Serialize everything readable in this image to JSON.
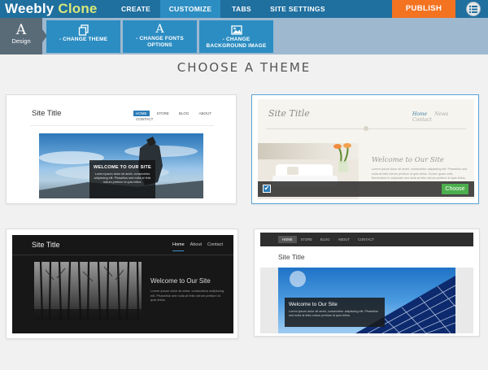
{
  "app": {
    "logo_primary": "Weebly",
    "logo_secondary": "Clone"
  },
  "topnav": {
    "tabs": [
      {
        "label": "CREATE",
        "active": false
      },
      {
        "label": "CUSTOMIZE",
        "active": true
      },
      {
        "label": "TABS",
        "active": false
      },
      {
        "label": "SITE SETTINGS",
        "active": false
      }
    ],
    "publish_label": "PUBLISH",
    "menu_icon": "list-menu-icon"
  },
  "subnav": {
    "design_label": "Design",
    "design_glyph": "A",
    "buttons": [
      {
        "label": "- CHANGE THEME",
        "icon": "copy-icon"
      },
      {
        "label": "- CHANGE FONTS OPTIONS",
        "glyph": "A",
        "icon": "font-icon"
      },
      {
        "label": "- CHANGE BACKGROUND IMAGE",
        "icon": "image-icon"
      }
    ]
  },
  "main": {
    "heading": "CHOOSE A THEME"
  },
  "themes": [
    {
      "site_title": "Site Title",
      "nav": [
        "HOME",
        "STORE",
        "BLOG",
        "ABOUT",
        "CONTACT"
      ],
      "hero_heading": "WELCOME TO OUR SITE",
      "hero_body": "Lorem ipsum dolor sit amet, consectetur adipiscing elit. Phasellus sed nulla at felis rutrum pretium id quis tellus.",
      "selected": false
    },
    {
      "site_title": "Site Title",
      "nav": [
        "Home",
        "News",
        "Contact"
      ],
      "welcome": "Welcome to Our Site",
      "body": "Lorem ipsum dolor sit amet, consectetur adipiscing elit. Phasellus sed nulla at felis rutrum pretium id quis tellus. Donec quam velit, fermentum in vulputate sed nulla at felis rutrum pretium id quis tellus.",
      "selected": true,
      "choose_label": "Choose",
      "check_glyph": "✔"
    },
    {
      "site_title": "Site Title",
      "nav": [
        "Home",
        "About",
        "Contact"
      ],
      "welcome": "Welcome to Our Site",
      "body": "Lorem ipsum dolor sit amet, consectetur adipiscing elit. Phasellus sed nulla at felis rutrum pretium id quis tellus.",
      "selected": false
    },
    {
      "site_title": "Site Title",
      "nav": [
        "HOME",
        "STORE",
        "BLOG",
        "ABOUT",
        "CONTACT"
      ],
      "welcome": "Welcome to Our Site",
      "body": "Lorem ipsum dolor sit amet, consectetur adipiscing elit. Phasellus sed nulla at felis rutrum pretium id quis tellus.",
      "selected": false
    }
  ],
  "colors": {
    "topbar": "#1f6f9f",
    "active_tab": "#2c8dc2",
    "publish": "#f37321",
    "subbar": "#9db8cf",
    "choose_button": "#4cae4c"
  }
}
